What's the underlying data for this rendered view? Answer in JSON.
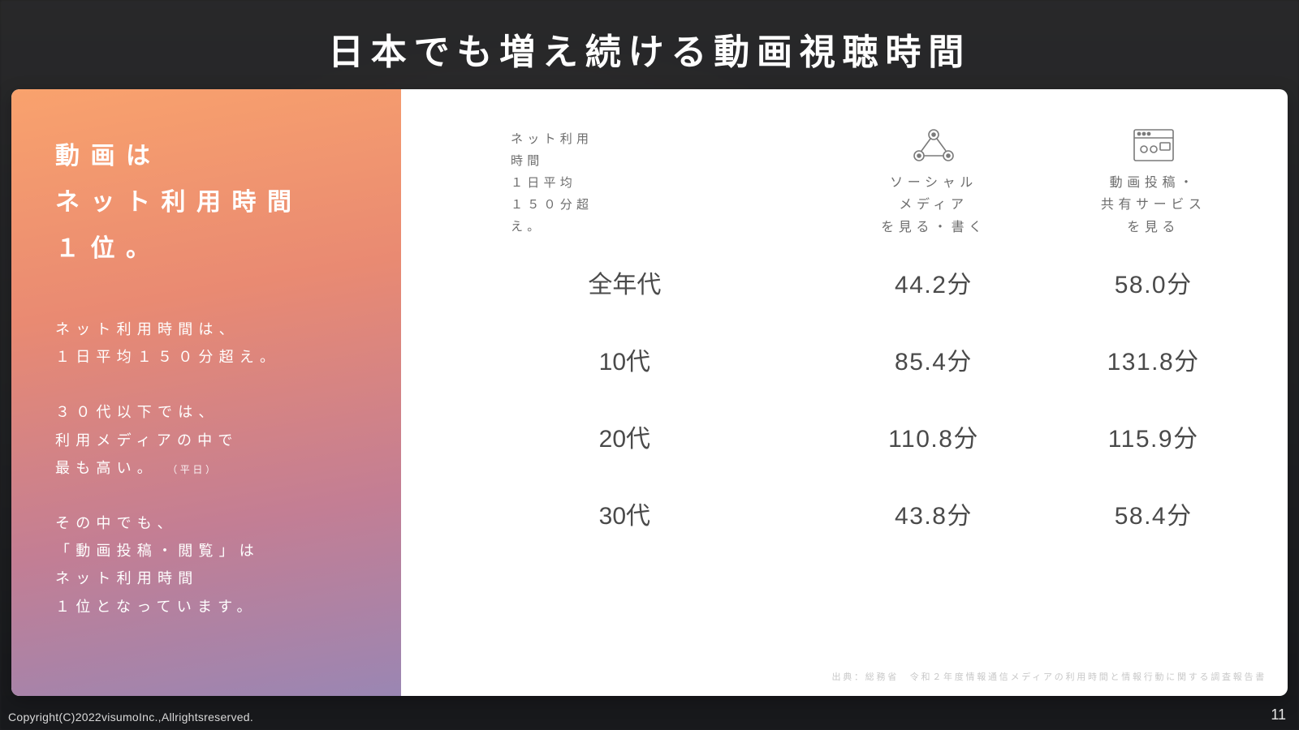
{
  "title": "日本でも増え続ける動画視聴時間",
  "left": {
    "headline_l1": "動画は",
    "headline_l2": "ネット利用時間",
    "headline_l3": "１位。",
    "p1_l1": "ネット利用時間は、",
    "p1_l2": "１日平均１５０分超え。",
    "p2_l1": "３０代以下では、",
    "p2_l2": "利用メディアの中で",
    "p2_l3": "最も高い。",
    "p2_note": "（平日）",
    "p3_l1": "その中でも、",
    "p3_l2": "「動画投稿・閲覧」は",
    "p3_l3": "ネット利用時間",
    "p3_l4": "１位となっています。"
  },
  "chart_data": {
    "type": "table",
    "col0_l1": "ネット利用時間",
    "col0_l2": "１日平均",
    "col0_l3": "１５０分超え。",
    "col1_l1": "ソーシャル",
    "col1_l2": "メディア",
    "col1_l3": "を見る・書く",
    "col2_l1": "動画投稿・",
    "col2_l2": "共有サービス",
    "col2_l3": "を見る",
    "columns": [
      "",
      "ソーシャルメディアを見る・書く",
      "動画投稿・共有サービスを見る"
    ],
    "rows": [
      {
        "label": "全年代",
        "social": "44.2分",
        "video": "58.0分"
      },
      {
        "label": "10代",
        "social": "85.4分",
        "video": "131.8分"
      },
      {
        "label": "20代",
        "social": "110.8分",
        "video": "115.9分"
      },
      {
        "label": "30代",
        "social": "43.8分",
        "video": "58.4分"
      }
    ],
    "source": "出典：総務省　令和２年度情報通信メディアの利用時間と情報行動に関する調査報告書"
  },
  "footer": {
    "copyright": "Copyright(C)2022visumoInc.,Allrightsreserved.",
    "page": "11"
  }
}
